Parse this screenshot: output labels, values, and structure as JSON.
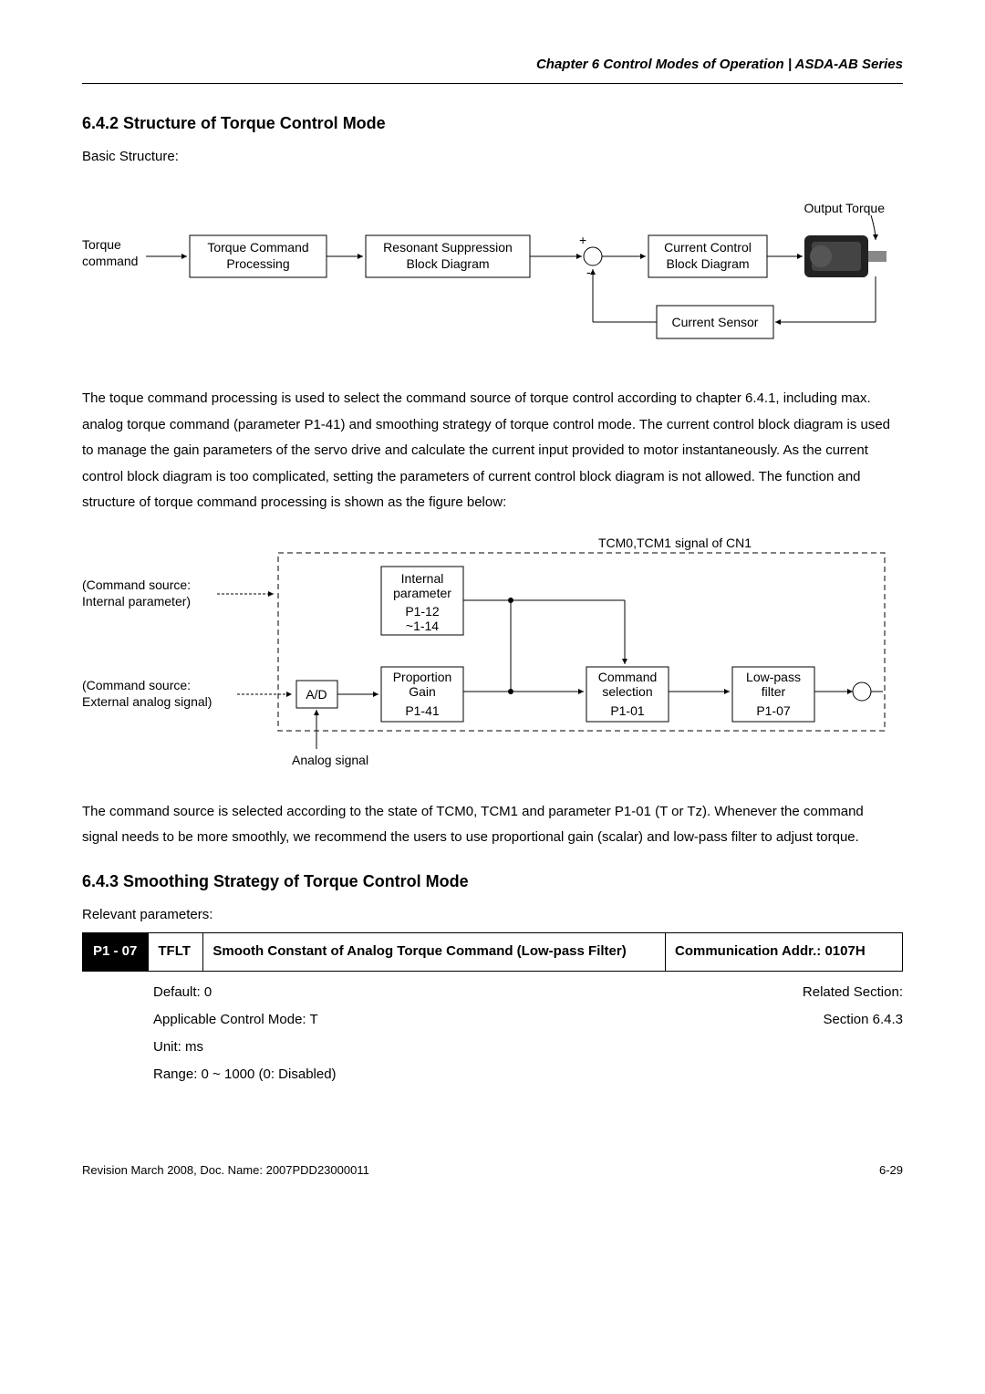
{
  "chapter_header": "Chapter 6  Control Modes of Operation | ASDA-AB Series",
  "section_642": {
    "title": "6.4.2  Structure of Torque Control Mode",
    "intro": "Basic Structure:",
    "para1": "The toque command processing is used to select the command source of torque control according to chapter 6.4.1, including max. analog torque command (parameter P1-41) and smoothing strategy of torque control mode. The current control block diagram is used to manage the gain parameters of the servo drive and calculate the current input provided to motor instantaneously. As the current control block diagram is too complicated, setting the parameters of current control block diagram is not allowed. The function and structure of torque command processing is shown as the figure below:",
    "para2": "The command source is selected according to the state of TCM0, TCM1 and parameter P1-01 (T or Tz). Whenever the command signal needs to be more smoothly, we recommend the users to use proportional gain (scalar) and low-pass filter to adjust torque."
  },
  "diagram1": {
    "torque_command": "Torque\ncommand",
    "torque_cmd_proc": "Torque Command\nProcessing",
    "resonant": "Resonant Suppression\nBlock Diagram",
    "current_control": "Current Control\nBlock Diagram",
    "current_sensor": "Current Sensor",
    "output_torque": "Output Torque"
  },
  "diagram2": {
    "cmd_src_internal": "(Command source:\nInternal parameter)",
    "cmd_src_external": "(Command source:\nExternal analog signal)",
    "ad": "A/D",
    "analog_signal": "Analog signal",
    "internal_param": "Internal\nparameter",
    "p112": "P1-12",
    "p114": "~1-14",
    "prop_gain": "Proportion\nGain",
    "p141": "P1-41",
    "cmd_sel": "Command\nselection",
    "p101": "P1-01",
    "lowpass": "Low-pass\nfilter",
    "p107": "P1-07",
    "tcm_signal": "TCM0,TCM1 signal of CN1"
  },
  "section_643": {
    "title": "6.4.3  Smoothing Strategy of Torque Control Mode",
    "intro": "Relevant parameters:"
  },
  "param": {
    "code": "P1 - 07",
    "label": "TFLT",
    "desc": "Smooth Constant of Analog Torque Command (Low-pass Filter)",
    "addr": "Communication Addr.: 0107H",
    "default": "Default: 0",
    "related": "Related Section:",
    "mode": "Applicable Control Mode: T",
    "section_ref": "Section 6.4.3",
    "unit": "Unit: ms",
    "range": "Range: 0 ~ 1000 (0: Disabled)"
  },
  "footer": {
    "left": "Revision March 2008, Doc. Name: 2007PDD23000011",
    "right": "6-29"
  }
}
